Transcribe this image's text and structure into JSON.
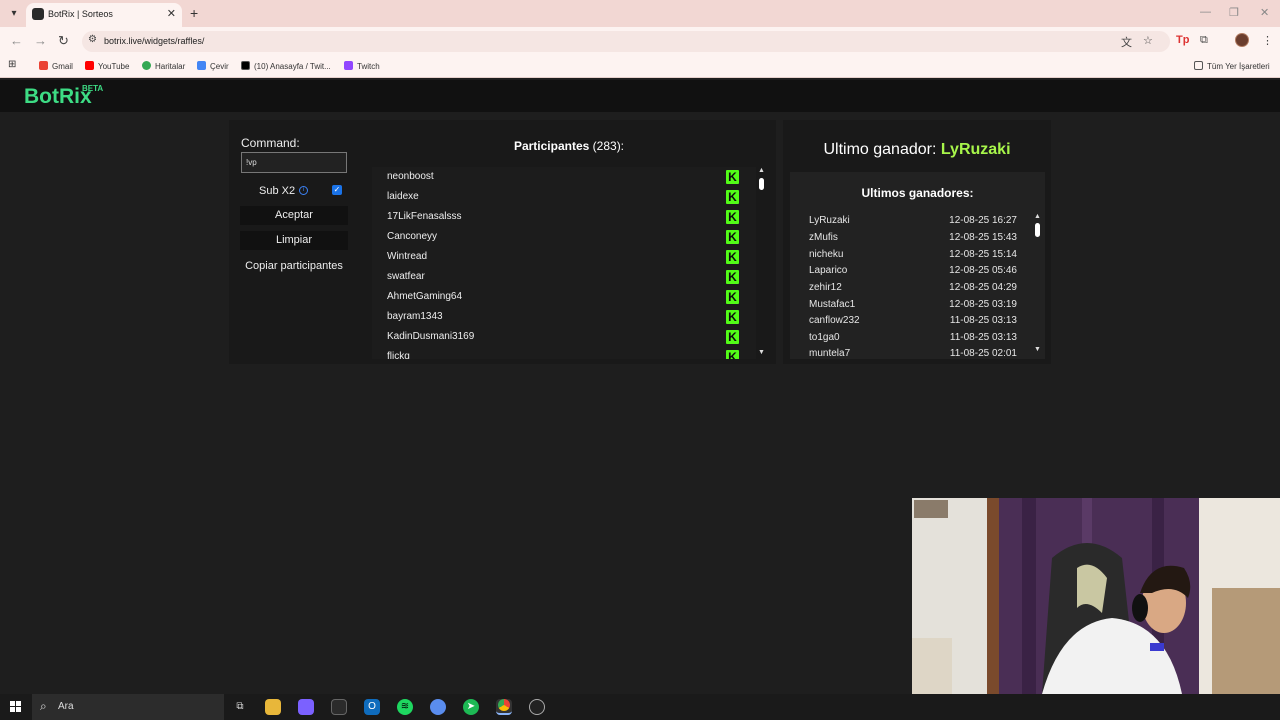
{
  "browser": {
    "tab_title": "BotRix | Sorteos",
    "url": "botrix.live/widgets/raffles/",
    "bookmarks": [
      "Gmail",
      "YouTube",
      "Haritalar",
      "Çevir",
      "(10) Anasayfa / Twit...",
      "Twitch"
    ],
    "all_bookmarks": "Tüm Yer İşaretleri"
  },
  "site": {
    "logo": "BotRix",
    "logo_badge": "BETA"
  },
  "controls": {
    "command_label": "Command:",
    "command_value": "!vp",
    "sub_label": "Sub X2",
    "sub_checked": true,
    "accept": "Aceptar",
    "clear": "Limpiar",
    "copy": "Copiar participantes"
  },
  "participants": {
    "title": "Participantes",
    "count": "(283):",
    "list": [
      "neonboost",
      "laidexe",
      "17LikFenasalsss",
      "Canconeyy",
      "Wintread",
      "swatfear",
      "AhmetGaming64",
      "bayram1343",
      "KadinDusmani3169",
      "flickq"
    ]
  },
  "winner": {
    "label": "Ultimo ganador:",
    "name": "LyRuzaki",
    "history_title": "Ultimos ganadores:",
    "history": [
      {
        "name": "LyRuzaki",
        "date": "12-08-25 16:27"
      },
      {
        "name": "zMufis",
        "date": "12-08-25 15:43"
      },
      {
        "name": "nicheku",
        "date": "12-08-25 15:14"
      },
      {
        "name": "Laparico",
        "date": "12-08-25 05:46"
      },
      {
        "name": "zehir12",
        "date": "12-08-25 04:29"
      },
      {
        "name": "Mustafac1",
        "date": "12-08-25 03:19"
      },
      {
        "name": "canflow232",
        "date": "11-08-25 03:13"
      },
      {
        "name": "to1ga0",
        "date": "11-08-25 03:13"
      },
      {
        "name": "muntela7",
        "date": "11-08-25 02:01"
      }
    ]
  },
  "taskbar": {
    "search": "Ara"
  },
  "colors": {
    "brand": "#3ddc84",
    "kick": "#53fc18",
    "winner": "#a7f54a"
  }
}
